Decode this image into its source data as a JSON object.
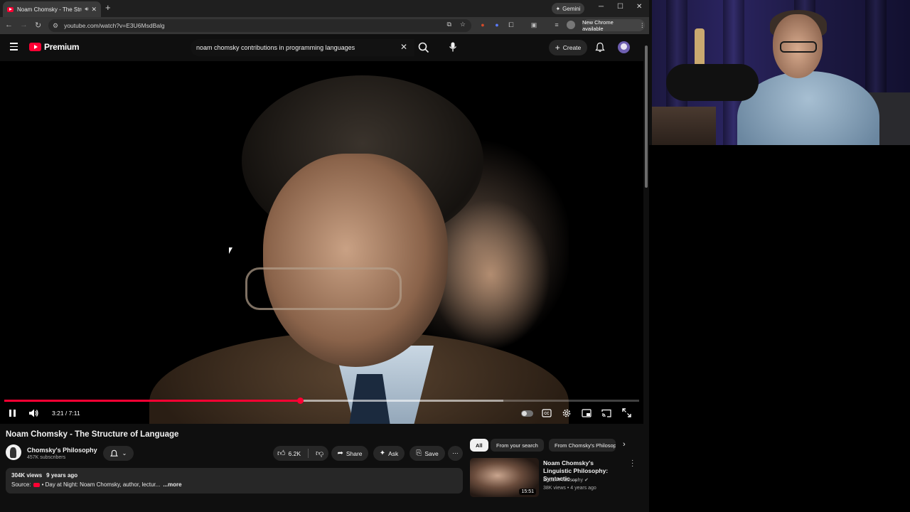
{
  "browser": {
    "tab_title": "Noam Chomsky - The Struc",
    "url": "youtube.com/watch?v=E3U6MsdBalg",
    "gemini_label": "Gemini",
    "update_label": "New Chrome available"
  },
  "youtube": {
    "logo_text": "Premium",
    "search_query": "noam chomsky contributions in programming languages",
    "create_label": "Create"
  },
  "player": {
    "current_time": "3:21",
    "duration": "7:11",
    "time_display": "3:21 / 7:11",
    "progress_fraction": 0.466,
    "buffered_fraction": 0.786
  },
  "video": {
    "title": "Noam Chomsky - The Structure of Language",
    "channel_name": "Chomsky's Philosophy",
    "subscribers": "457K subscribers",
    "likes": "6.2K",
    "share_label": "Share",
    "ask_label": "Ask",
    "save_label": "Save",
    "views": "304K views",
    "age": "9 years ago",
    "source_label": "Source:",
    "source_text": "Day at Night: Noam Chomsky, author, lectur...",
    "more_label": "...more"
  },
  "chips": [
    "All",
    "From your search",
    "From Chomsky's Philosophy"
  ],
  "recommendation": {
    "title": "Noam Chomsky's Linguistic Philosophy: Syntactic ...",
    "channel": "Epoch Philosophy",
    "meta": "38K views • 4 years ago",
    "duration": "15:51"
  },
  "colors": {
    "youtube_red": "#ff0033",
    "background": "#0f0f0f",
    "pill": "#272727"
  }
}
